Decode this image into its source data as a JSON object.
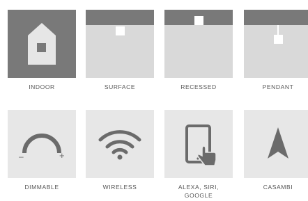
{
  "features": [
    {
      "id": "indoor",
      "label": "INDOOR",
      "icon": "house-icon"
    },
    {
      "id": "surface",
      "label": "SURFACE",
      "icon": "surface-mount-icon"
    },
    {
      "id": "recessed",
      "label": "RECESSED",
      "icon": "recessed-mount-icon"
    },
    {
      "id": "pendant",
      "label": "PENDANT",
      "icon": "pendant-mount-icon"
    },
    {
      "id": "dimmable",
      "label": "DIMMABLE",
      "icon": "dimmer-dial-icon",
      "minus": "–",
      "plus": "+"
    },
    {
      "id": "wireless",
      "label": "WIRELESS",
      "icon": "wifi-icon"
    },
    {
      "id": "voice",
      "label_line1": "ALEXA, SIRI,",
      "label_line2": "GOOGLE",
      "icon": "smartphone-touch-icon"
    },
    {
      "id": "casambi",
      "label": "CASAMBI",
      "icon": "casambi-logo-icon"
    }
  ],
  "colors": {
    "dark_tile": "#797979",
    "light_tile": "#d9d9d9",
    "pale_tile": "#e7e7e7",
    "icon": "#6b6b6b",
    "label": "#555555"
  }
}
